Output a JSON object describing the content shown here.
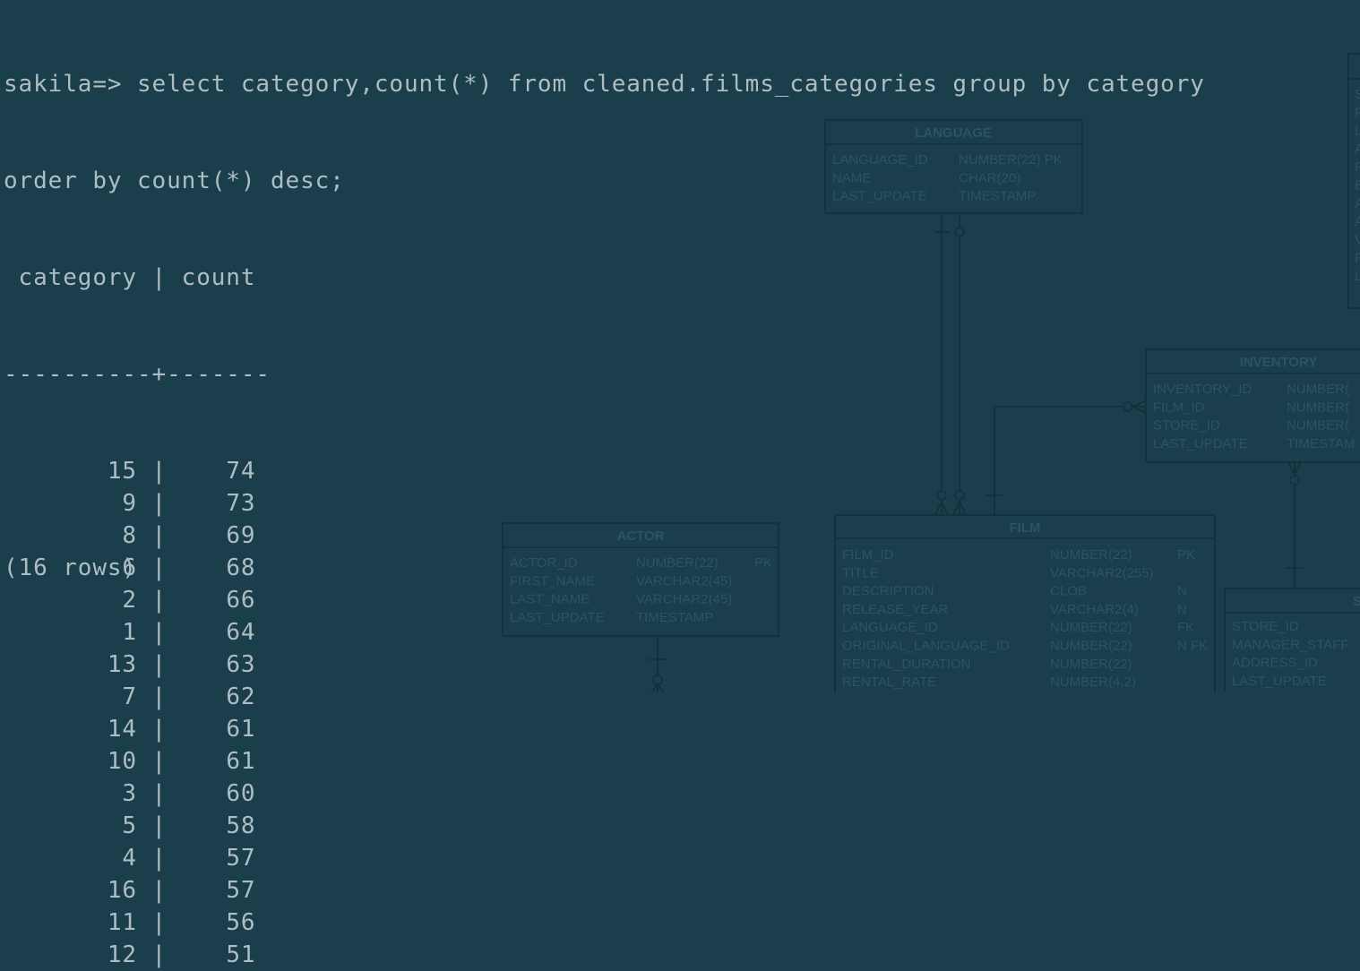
{
  "terminal": {
    "prompt": "sakila=> ",
    "command_line1": "select category,count(*) from cleaned.films_categories group by category",
    "command_line2": "order by count(*) desc;",
    "header": " category | count",
    "separator": "----------+-------",
    "rows": [
      {
        "category": 15,
        "count": 74
      },
      {
        "category": 9,
        "count": 73
      },
      {
        "category": 8,
        "count": 69
      },
      {
        "category": 6,
        "count": 68
      },
      {
        "category": 2,
        "count": 66
      },
      {
        "category": 1,
        "count": 64
      },
      {
        "category": 13,
        "count": 63
      },
      {
        "category": 7,
        "count": 62
      },
      {
        "category": 14,
        "count": 61
      },
      {
        "category": 10,
        "count": 61
      },
      {
        "category": 3,
        "count": 60
      },
      {
        "category": 5,
        "count": 58
      },
      {
        "category": 4,
        "count": 57
      },
      {
        "category": 16,
        "count": 57
      },
      {
        "category": 11,
        "count": 56
      },
      {
        "category": 12,
        "count": 51
      }
    ],
    "footer": "(16 rows)"
  },
  "wallpaper_diagram": {
    "language": {
      "title": "LANGUAGE",
      "rows": [
        [
          "LANGUAGE_ID",
          "NUMBER(22) PK"
        ],
        [
          "NAME",
          "CHAR(20)"
        ],
        [
          "LAST_UPDATE",
          "TIMESTAMP"
        ]
      ]
    },
    "inventory": {
      "title": "INVENTORY",
      "rows": [
        [
          "INVENTORY_ID",
          "NUMBER("
        ],
        [
          "FILM_ID",
          "NUMBER("
        ],
        [
          "STORE_ID",
          "NUMBER("
        ],
        [
          "LAST_UPDATE",
          "TIMESTAM"
        ]
      ]
    },
    "actor": {
      "title": "ACTOR",
      "rows": [
        [
          "ACTOR_ID",
          "NUMBER(22)",
          "PK"
        ],
        [
          "FIRST_NAME",
          "VARCHAR2(45)",
          ""
        ],
        [
          "LAST_NAME",
          "VARCHAR2(45)",
          ""
        ],
        [
          "LAST_UPDATE",
          "TIMESTAMP",
          ""
        ]
      ]
    },
    "film": {
      "title": "FILM",
      "rows": [
        [
          "FILM_ID",
          "NUMBER(22)",
          "PK"
        ],
        [
          "TITLE",
          "VARCHAR2(255)",
          ""
        ],
        [
          "DESCRIPTION",
          "CLOB",
          "N"
        ],
        [
          "RELEASE_YEAR",
          "VARCHAR2(4)",
          "N"
        ],
        [
          "LANGUAGE_ID",
          "NUMBER(22)",
          "FK"
        ],
        [
          "ORIGINAL_LANGUAGE_ID",
          "NUMBER(22)",
          "N FK"
        ],
        [
          "RENTAL_DURATION",
          "NUMBER(22)",
          ""
        ],
        [
          "RENTAL_RATE",
          "NUMBER(4,2)",
          ""
        ]
      ]
    },
    "store": {
      "title": "S",
      "rows": [
        [
          "STORE_ID"
        ],
        [
          "MANAGER_STAFF"
        ],
        [
          "ADDRESS_ID"
        ],
        [
          "LAST_UPDATE"
        ]
      ]
    },
    "topright_letters": [
      "S",
      "F",
      "L",
      "A",
      "F",
      "E",
      "A",
      "A",
      "V",
      "F",
      "L"
    ]
  }
}
